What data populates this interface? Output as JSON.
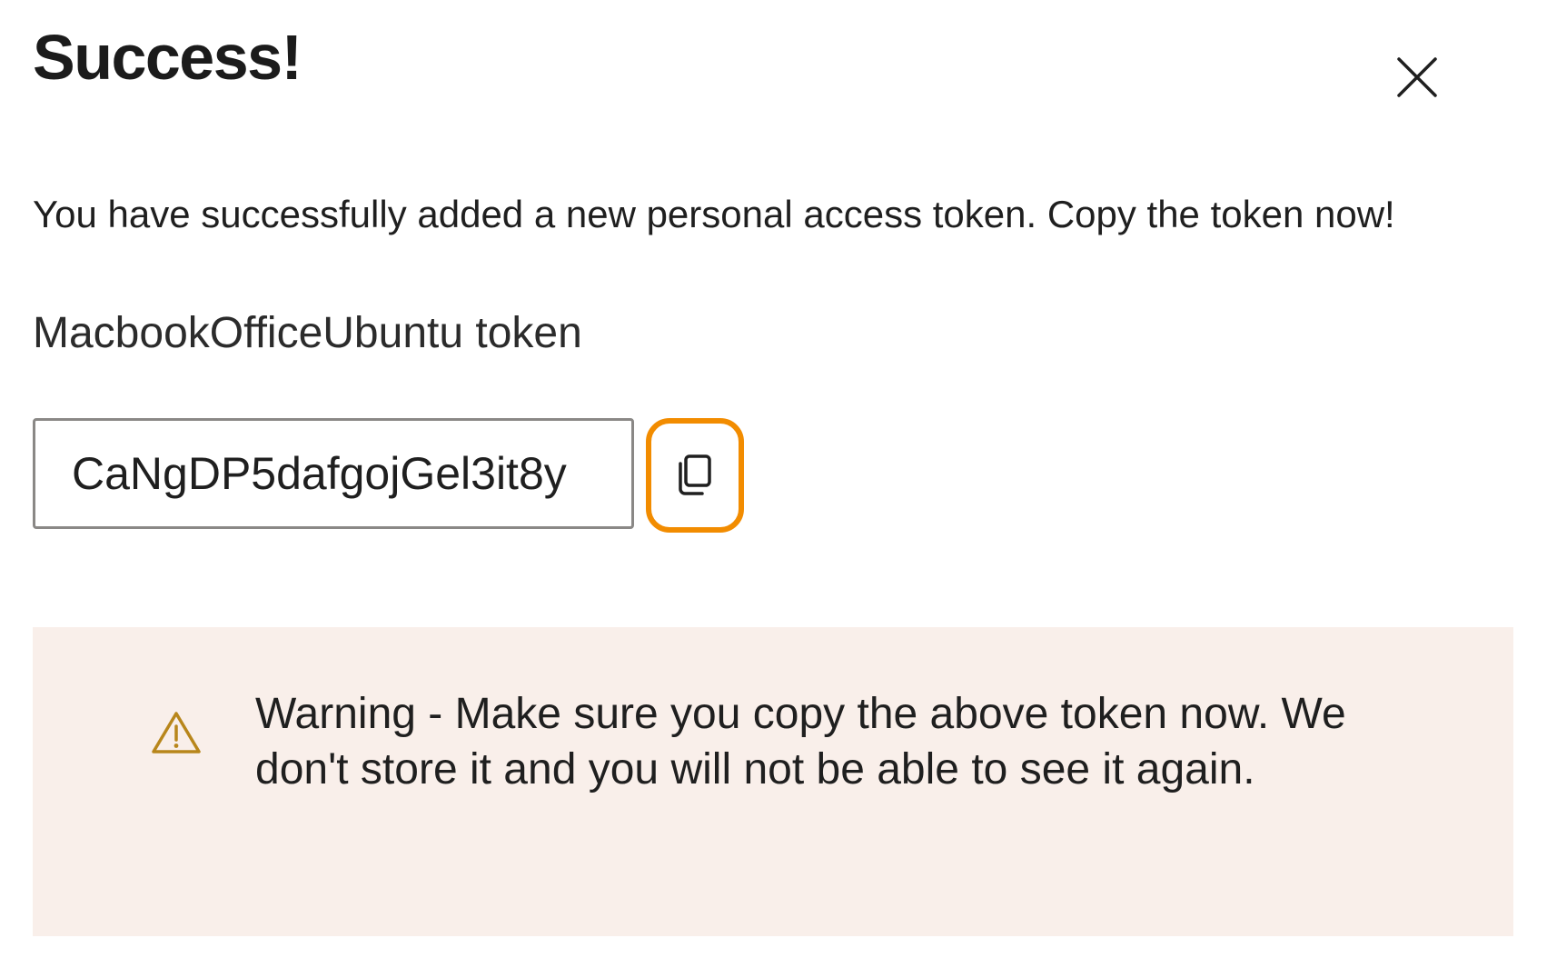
{
  "dialog": {
    "title": "Success!",
    "message": "You have successfully added a new personal access token. Copy the token now!",
    "token_name": "MacbookOfficeUbuntu token",
    "token_value": "CaNgDP5dafgojGel3it8y",
    "close_icon": "close-icon",
    "copy_icon": "copy-icon",
    "warning": {
      "icon": "warning-icon",
      "text": "Warning - Make sure you copy the above token now. We don't store it and you will not be able to see it again.",
      "background": "#f9efea",
      "icon_color": "#b8861b"
    },
    "highlight_color": "#f28c00"
  }
}
